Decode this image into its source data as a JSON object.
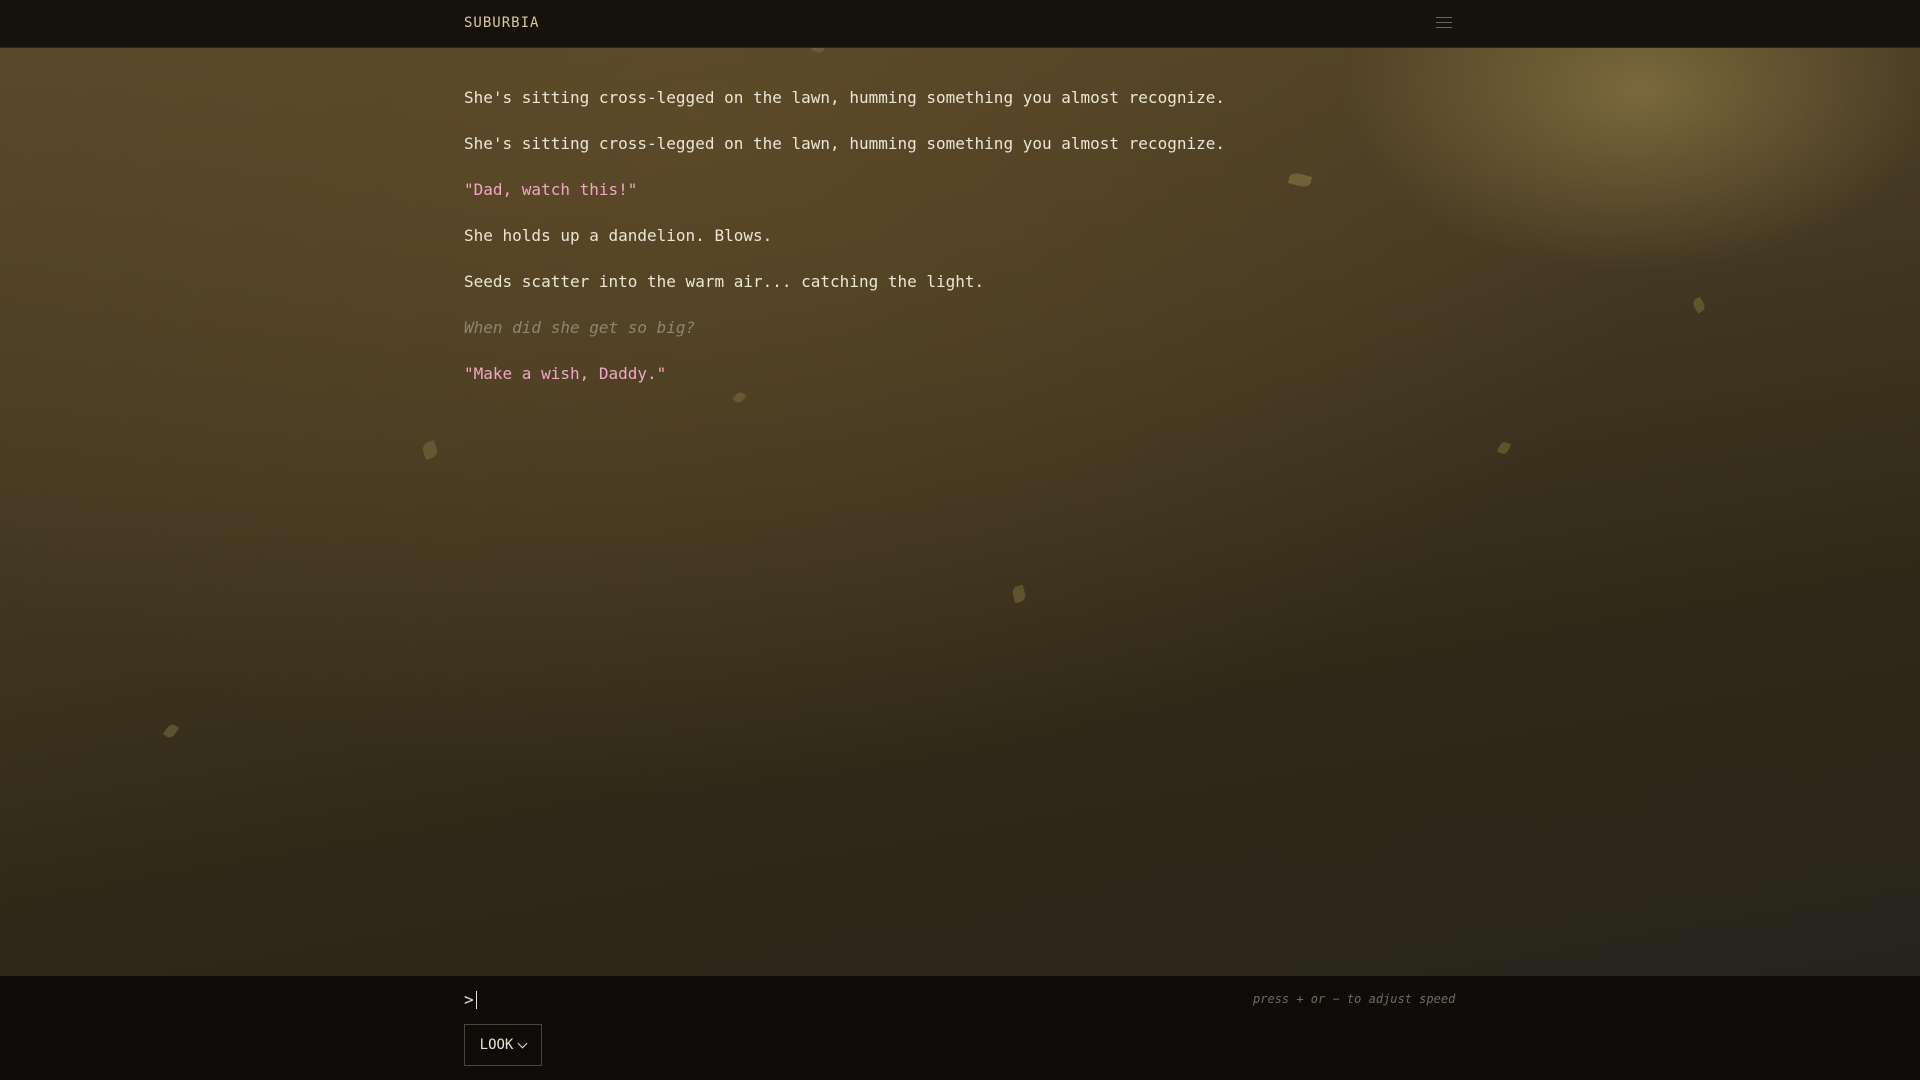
{
  "header": {
    "title": "SUBURBIA",
    "menu_icon": "hamburger-menu-icon"
  },
  "story": {
    "lines": [
      {
        "text": "She's sitting cross-legged on the lawn, humming something you almost recognize.",
        "style": "narration"
      },
      {
        "text": "She's sitting cross-legged on the lawn, humming something you almost recognize.",
        "style": "narration"
      },
      {
        "text": "\"Dad, watch this!\"",
        "style": "dialog"
      },
      {
        "text": "She holds up a dandelion. Blows.",
        "style": "narration"
      },
      {
        "text": "Seeds scatter into the warm air... catching the light.",
        "style": "narration"
      },
      {
        "text": "When did she get so big?",
        "style": "thought"
      },
      {
        "text": "\"Make a wish, Daddy.\"",
        "style": "dialog"
      }
    ]
  },
  "input": {
    "prompt_symbol": ">",
    "value": "",
    "speed_hint": "press + or − to adjust speed"
  },
  "actions": {
    "look_label": "LOOK",
    "look_icon": "chevron-down-icon"
  },
  "colors": {
    "dialog": "#f1a6c6",
    "narration": "#ece6d6",
    "thought": "#8b8674",
    "title": "#d8c79c"
  }
}
